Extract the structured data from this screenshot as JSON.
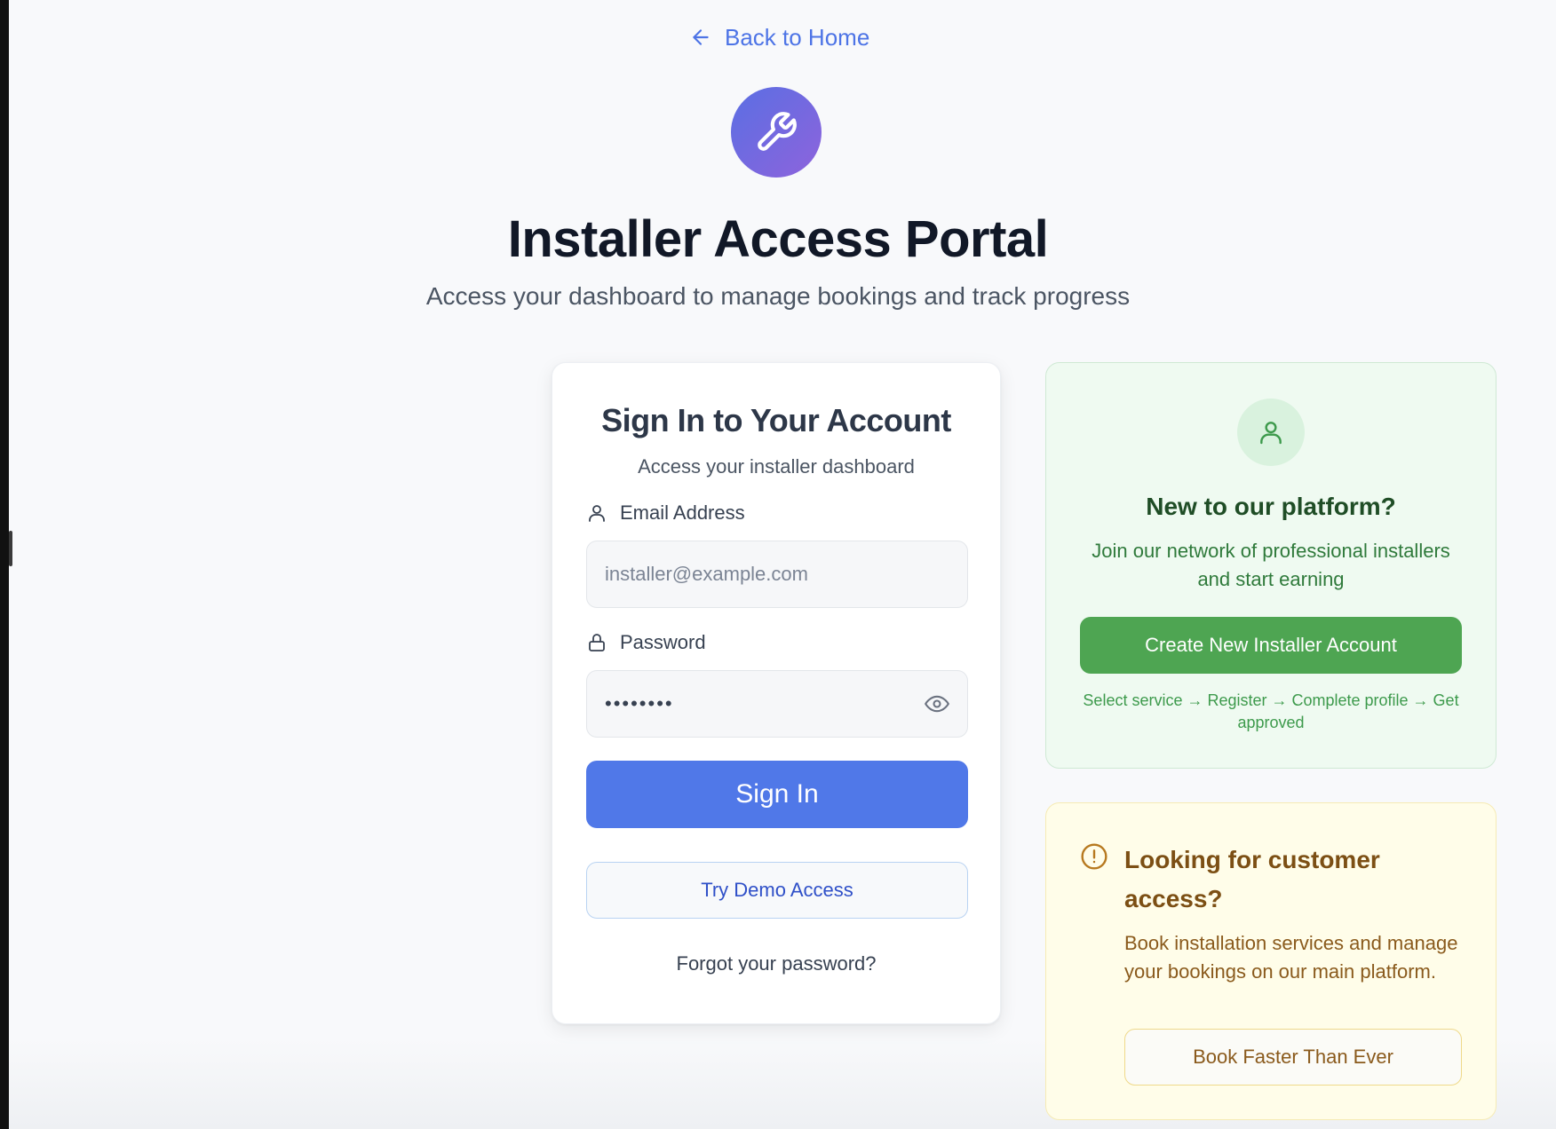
{
  "nav": {
    "back_label": "Back to Home"
  },
  "header": {
    "title": "Installer Access Portal",
    "subtitle": "Access your dashboard to manage bookings and track progress",
    "logo_icon": "wrench-icon"
  },
  "signin": {
    "title": "Sign In to Your Account",
    "subtitle": "Access your installer dashboard",
    "email_label": "Email Address",
    "email_placeholder": "installer@example.com",
    "email_value": "",
    "password_label": "Password",
    "password_value": "••••••••",
    "submit_label": "Sign In",
    "demo_label": "Try Demo Access",
    "forgot_label": "Forgot your password?"
  },
  "new_installer": {
    "title": "New to our platform?",
    "text": "Join our network of professional installers and start earning",
    "button_label": "Create New Installer Account",
    "steps": "Select service → Register → Complete profile → Get approved"
  },
  "customer": {
    "title": "Looking for customer access?",
    "text": "Book installation services and manage your bookings on our main platform.",
    "button_label": "Book Faster Than Ever"
  },
  "colors": {
    "primary": "#5078e8",
    "accent_gradient_start": "#5a6fe3",
    "accent_gradient_end": "#8e63dc",
    "success": "#4ea552",
    "warning_text": "#7c4f14",
    "background": "#f8f9fb"
  }
}
